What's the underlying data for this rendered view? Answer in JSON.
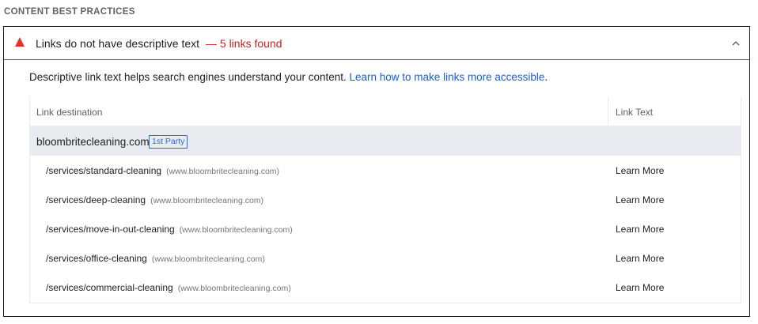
{
  "section": {
    "title": "CONTENT BEST PRACTICES"
  },
  "audit": {
    "title": "Links do not have descriptive text",
    "count": "— 5 links found",
    "description": "Descriptive link text helps search engines understand your content.",
    "learn_link": "Learn how to make links more accessible",
    "description_end": "."
  },
  "table": {
    "headers": {
      "destination": "Link destination",
      "text": "Link Text"
    },
    "group": {
      "name": "bloombritecleaning.com",
      "badge": "1st Party"
    },
    "rows": [
      {
        "path": "/services/standard-cleaning",
        "host": "(www.bloombritecleaning.com)",
        "link_text": "Learn More"
      },
      {
        "path": "/services/deep-cleaning",
        "host": "(www.bloombritecleaning.com)",
        "link_text": "Learn More"
      },
      {
        "path": "/services/move-in-out-cleaning",
        "host": "(www.bloombritecleaning.com)",
        "link_text": "Learn More"
      },
      {
        "path": "/services/office-cleaning",
        "host": "(www.bloombritecleaning.com)",
        "link_text": "Learn More"
      },
      {
        "path": "/services/commercial-cleaning",
        "host": "(www.bloombritecleaning.com)",
        "link_text": "Learn More"
      }
    ]
  },
  "colors": {
    "warning": "#e8322d",
    "fail_text": "#c5221f",
    "link": "#1a5ed8",
    "accent_border": "#2962d6"
  },
  "icons": {
    "status": "warning-triangle-icon",
    "toggle": "chevron-up-icon"
  }
}
